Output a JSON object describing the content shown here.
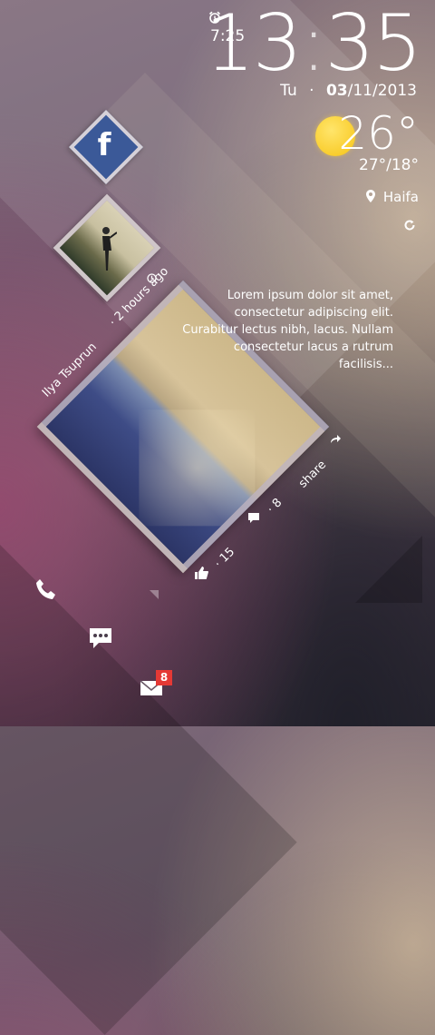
{
  "clock": {
    "hours": "13",
    "colon": ":",
    "minutes": "35"
  },
  "alarm": {
    "icon": "alarm-clock-icon",
    "time": "7:25"
  },
  "date": {
    "day": "Tu",
    "separator": "·",
    "date_bold": "03",
    "date_rest": "/11/2013"
  },
  "weather": {
    "icon": "sun-icon",
    "temperature": "26°",
    "high_low": "27°/18°",
    "location": "Haifa",
    "refresh_icon": "refresh-icon"
  },
  "social": {
    "network_icon": "facebook-icon",
    "network_letter": "f",
    "author": "Ilya Tsuprun",
    "time_ago": "· 2 hours ago",
    "post_text": "Lorem ipsum dolor sit amet, consectetur   adipiscing elit. Curabitur lectus nibh, lacus. Nullam consectetur lacus a rutrum facilisis...",
    "likes": "· 15",
    "comments": "· 8",
    "share_label": "share"
  },
  "dock": {
    "phone_icon": "phone-icon",
    "message_icon": "chat-icon",
    "mail_icon": "mail-icon",
    "mail_badge": "8"
  },
  "colors": {
    "facebook": "#3b5998",
    "sun": "#f7c415",
    "badge": "#e53935"
  }
}
